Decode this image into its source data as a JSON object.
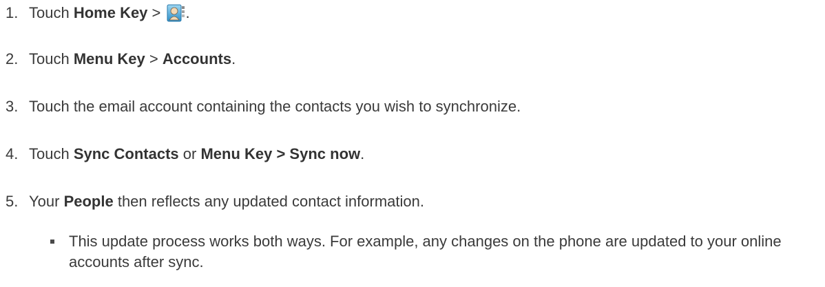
{
  "steps": [
    {
      "num": "1.",
      "pre": "Touch ",
      "b1": "Home Key",
      "mid": " > ",
      "icon": "people-app-icon",
      "post": "."
    },
    {
      "num": "2.",
      "pre": "Touch ",
      "b1": "Menu Key",
      "mid": " > ",
      "b2": "Accounts",
      "post": "."
    },
    {
      "num": "3.",
      "text": "Touch the email account containing the contacts you wish to synchronize."
    },
    {
      "num": "4.",
      "pre": "Touch ",
      "b1": "Sync Contacts",
      "mid": " or ",
      "b2": "Menu Key > Sync now",
      "post": "."
    },
    {
      "num": "5.",
      "pre": "Your ",
      "b1": "People",
      "post": " then reflects any updated contact information."
    }
  ],
  "bullet": {
    "text": "This update process works both ways. For example, any changes on the phone are updated to your online accounts after sync."
  }
}
